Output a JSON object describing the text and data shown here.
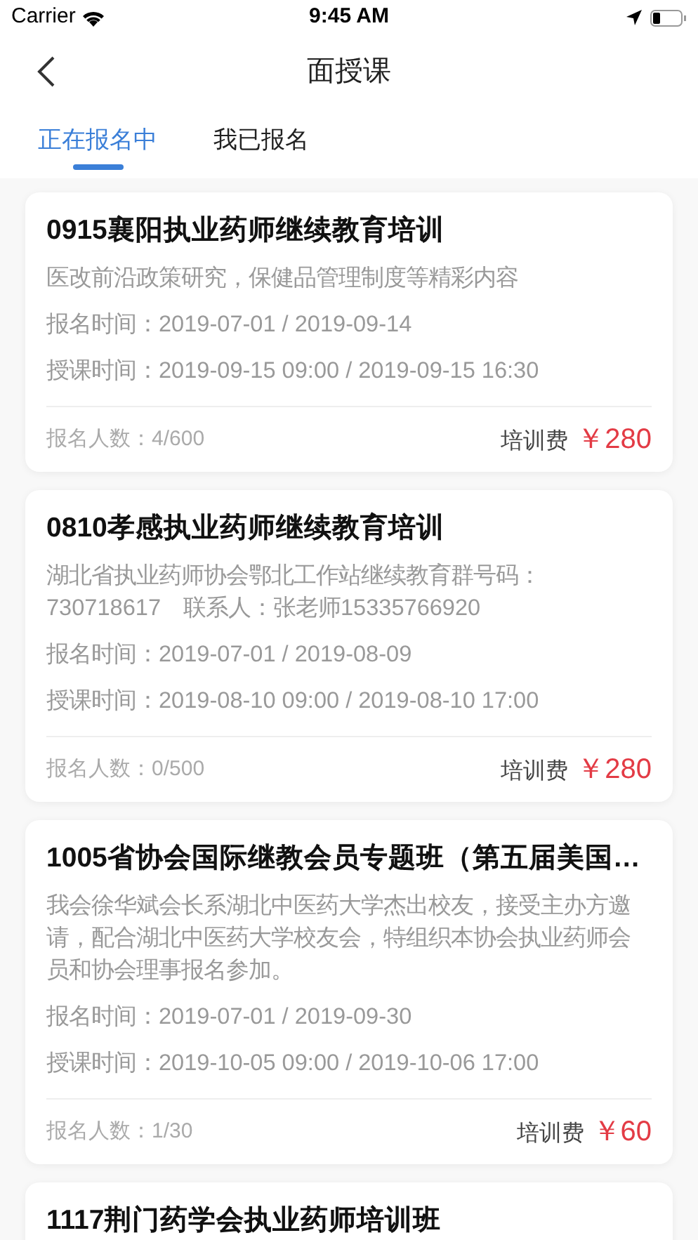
{
  "status_bar": {
    "carrier": "Carrier",
    "time": "9:45 AM"
  },
  "nav": {
    "title": "面授课"
  },
  "tabs": [
    {
      "label": "正在报名中",
      "selected": true
    },
    {
      "label": "我已报名",
      "selected": false
    }
  ],
  "courses": [
    {
      "title": "0915襄阳执业药师继续教育培训",
      "description": "医改前沿政策研究，保健品管理制度等精彩内容",
      "signup_period": "报名时间：2019-07-01 / 2019-09-14",
      "class_period": "授课时间：2019-09-15 09:00 / 2019-09-15 16:30",
      "enrollment": "报名人数：4/600",
      "fee_label": "培训费",
      "price": "￥280"
    },
    {
      "title": "0810孝感执业药师继续教育培训",
      "description": "湖北省执业药师协会鄂北工作站继续教育群号码：730718617　联系人：张老师15335766920",
      "signup_period": "报名时间：2019-07-01 / 2019-08-09",
      "class_period": "授课时间：2019-08-10 09:00 / 2019-08-10 17:00",
      "enrollment": "报名人数：0/500",
      "fee_label": "培训费",
      "price": "￥280"
    },
    {
      "title": "1005省协会国际继教会员专题班（第五届美国…",
      "description": "我会徐华斌会长系湖北中医药大学杰出校友，接受主办方邀请，配合湖北中医药大学校友会，特组织本协会执业药师会员和协会理事报名参加。",
      "signup_period": "报名时间：2019-07-01 / 2019-09-30",
      "class_period": "授课时间：2019-10-05 09:00 / 2019-10-06 17:00",
      "enrollment": "报名人数：1/30",
      "fee_label": "培训费",
      "price": "￥60"
    },
    {
      "title": "1117荆门药学会执业药师培训班"
    }
  ]
}
